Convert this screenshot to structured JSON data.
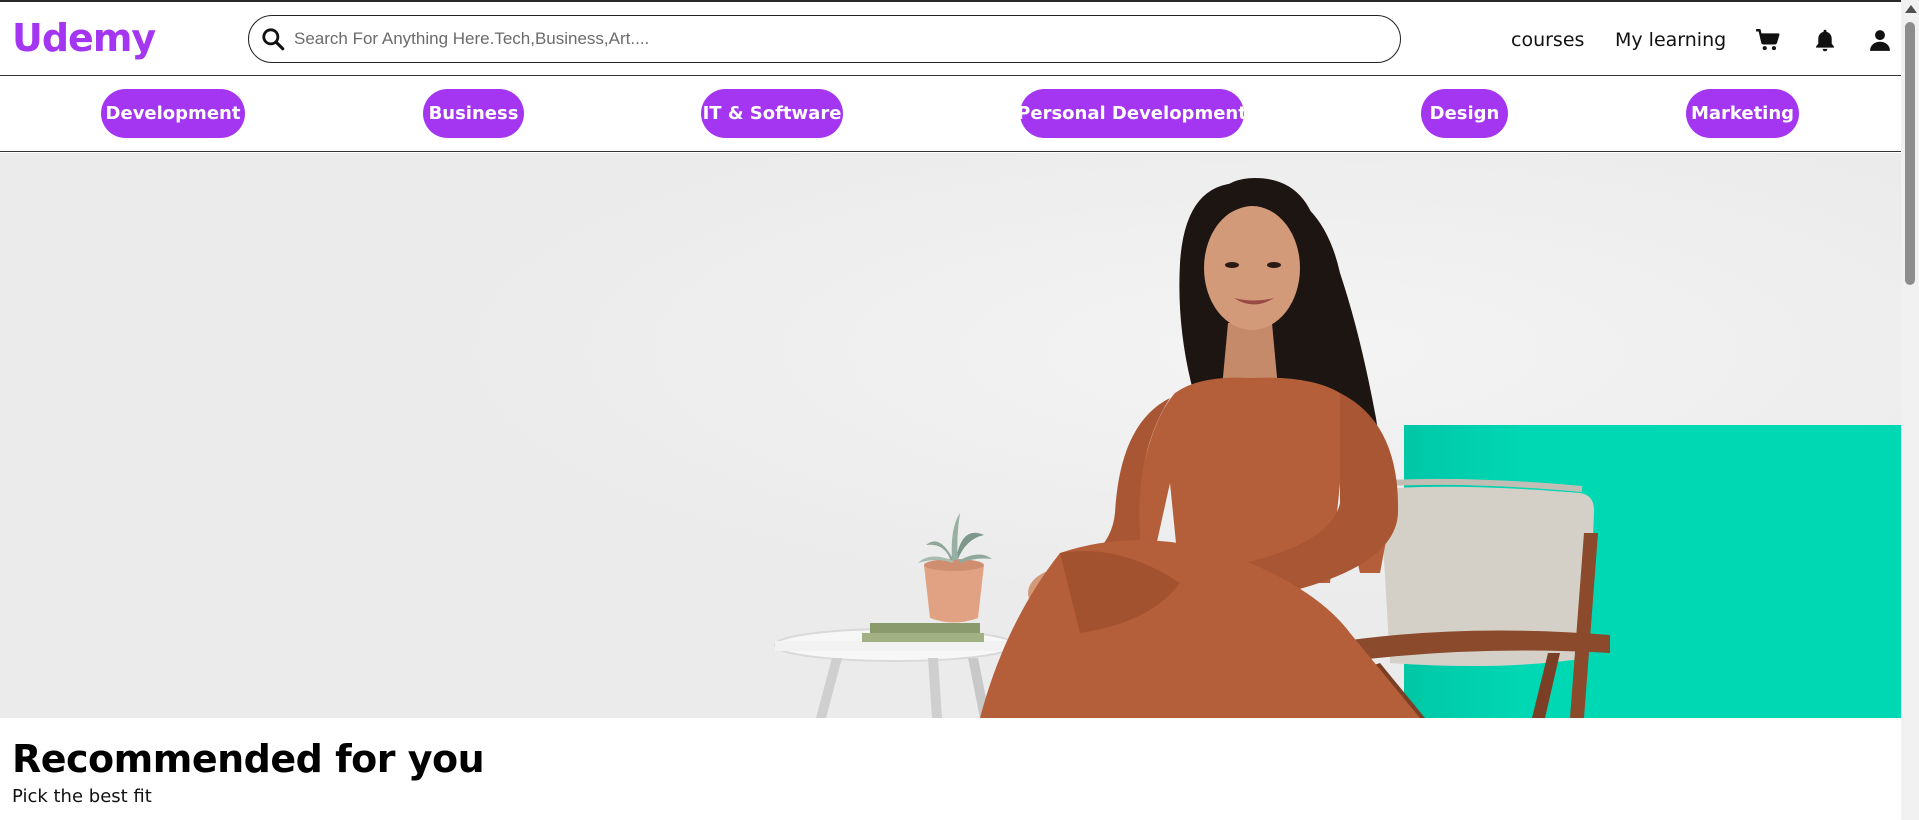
{
  "brand": {
    "name": "Udemy",
    "accent": "#a435f0"
  },
  "search": {
    "placeholder": "Search For Anything Here.Tech,Business,Art...."
  },
  "header": {
    "nav": {
      "courses": "courses",
      "my_learning": "My learning"
    },
    "icons": [
      "search-icon",
      "cart-icon",
      "bell-icon",
      "user-icon"
    ]
  },
  "categories": [
    "Development",
    "Business",
    "IT & Software",
    "Personal Development",
    "Design",
    "Marketing"
  ],
  "hero": {
    "background": "#ebebeb",
    "accent_panel": "#00d4b0"
  },
  "section": {
    "title": "Recommended for you",
    "subtitle": "Pick the best fit"
  }
}
